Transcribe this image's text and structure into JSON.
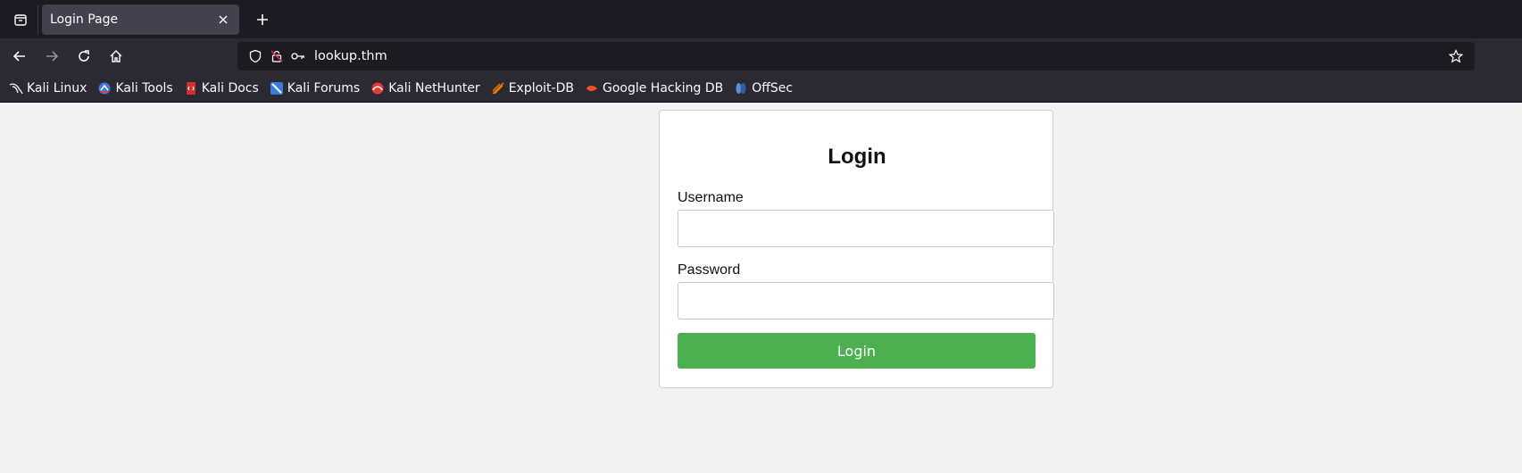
{
  "browser": {
    "tab": {
      "title": "Login Page"
    },
    "url": "lookup.thm",
    "bookmarks": [
      {
        "label": "Kali Linux",
        "icon": "kali-dragon-icon",
        "color": "#e6e6e6"
      },
      {
        "label": "Kali Tools",
        "icon": "kali-tools-icon",
        "color": "#3b7ae0"
      },
      {
        "label": "Kali Docs",
        "icon": "kali-docs-icon",
        "color": "#d32f2f"
      },
      {
        "label": "Kali Forums",
        "icon": "kali-forums-icon",
        "color": "#3b7ae0"
      },
      {
        "label": "Kali NetHunter",
        "icon": "kali-nethunter-icon",
        "color": "#e53935"
      },
      {
        "label": "Exploit-DB",
        "icon": "exploit-db-icon",
        "color": "#f57c00"
      },
      {
        "label": "Google Hacking DB",
        "icon": "ghdb-icon",
        "color": "#f4511e"
      },
      {
        "label": "OffSec",
        "icon": "offsec-icon",
        "color": "#5c8dd6"
      }
    ]
  },
  "login": {
    "heading": "Login",
    "username_label": "Username",
    "username_value": "",
    "password_label": "Password",
    "password_value": "",
    "submit_label": "Login",
    "submit_color": "#4caf50"
  }
}
